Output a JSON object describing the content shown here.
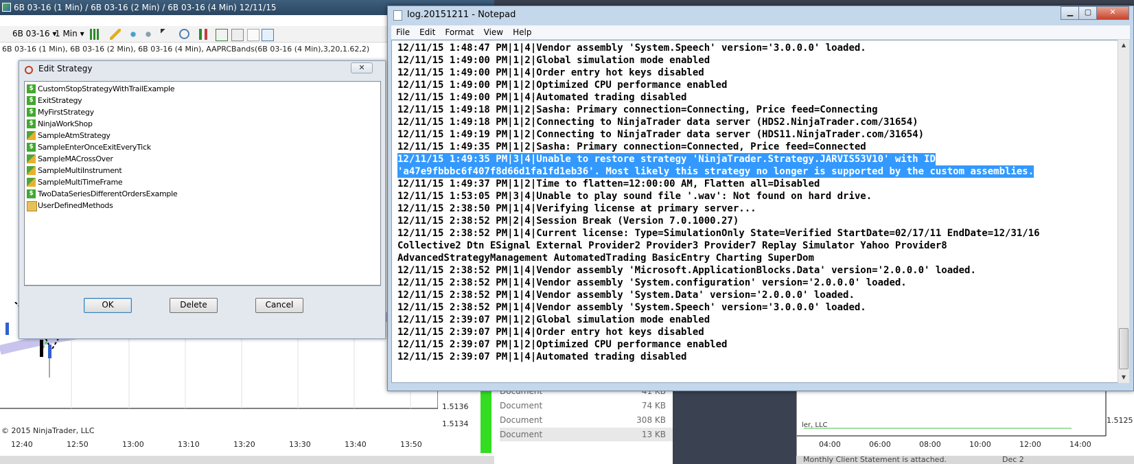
{
  "chart": {
    "title": "6B 03-16 (1 Min) / 6B 03-16 (2 Min) / 6B 03-16 (4 Min)  12/11/15",
    "instrument": "6B 03-16",
    "interval": "1 Min",
    "description": "6B 03-16 (1 Min), 6B 03-16 (2 Min), 6B 03-16 (4 Min), AAPRCBands(6B 03-16 (4 Min),3,20,1.62,2)",
    "copyright": "© 2015 NinjaTrader, LLC",
    "x_labels": [
      "12:40",
      "12:50",
      "13:00",
      "13:10",
      "13:20",
      "13:30",
      "13:40",
      "13:50"
    ],
    "price_labels": [
      "1.5136",
      "1.5134"
    ]
  },
  "explorer": {
    "rows": [
      {
        "type": "Document",
        "size": "41 KB"
      },
      {
        "type": "Document",
        "size": "74 KB"
      },
      {
        "type": "Document",
        "size": "308 KB"
      },
      {
        "type": "Document",
        "size": "13 KB"
      }
    ]
  },
  "right_chart": {
    "x_labels": [
      "04:00",
      "06:00",
      "08:00",
      "10:00",
      "12:00",
      "14:00"
    ],
    "price_label": "1.5125",
    "partial_text": "ler, LLC",
    "bottom_text": "Monthly Client Statement is attached.",
    "bottom_right": "Dec 2"
  },
  "notepad": {
    "title": "log.20151211 - Notepad",
    "menu": [
      "File",
      "Edit",
      "Format",
      "View",
      "Help"
    ],
    "lines": [
      "12/11/15 1:48:47 PM|1|4|Vendor assembly 'System.Speech' version='3.0.0.0' loaded.",
      "12/11/15 1:49:00 PM|1|2|Global simulation mode enabled",
      "12/11/15 1:49:00 PM|1|4|Order entry hot keys disabled",
      "12/11/15 1:49:00 PM|1|2|Optimized CPU performance enabled",
      "12/11/15 1:49:00 PM|1|4|Automated trading disabled",
      "12/11/15 1:49:18 PM|1|2|Sasha: Primary connection=Connecting, Price feed=Connecting",
      "12/11/15 1:49:18 PM|1|2|Connecting to NinjaTrader data server (HDS2.NinjaTrader.com/31654)",
      "12/11/15 1:49:19 PM|1|2|Connecting to NinjaTrader data server (HDS11.NinjaTrader.com/31654)",
      "12/11/15 1:49:35 PM|1|2|Sasha: Primary connection=Connected, Price feed=Connected",
      "12/11/15 1:49:35 PM|3|4|Unable to restore strategy 'NinjaTrader.Strategy.JARVIS53V10' with ID",
      "'a47e9fbbbc6f407f8d66d1fa1fd1eb36'. Most likely this strategy no longer is supported by the custom assemblies.",
      "12/11/15 1:49:37 PM|1|2|Time to flatten=12:00:00 AM, Flatten all=Disabled",
      "12/11/15 1:53:05 PM|3|4|Unable to play sound file '.wav': Not found on hard drive.",
      "12/11/15 2:38:50 PM|1|4|Verifying license at primary server...",
      "12/11/15 2:38:52 PM|2|4|Session Break (Version 7.0.1000.27)",
      "12/11/15 2:38:52 PM|1|4|Current license: Type=SimulationOnly State=Verified StartDate=02/17/11 EndDate=12/31/16",
      "Collective2 Dtn ESignal External Provider2 Provider3 Provider7 Replay Simulator Yahoo Provider8",
      "AdvancedStrategyManagement AutomatedTrading BasicEntry Charting SuperDom",
      "12/11/15 2:38:52 PM|1|4|Vendor assembly 'Microsoft.ApplicationBlocks.Data' version='2.0.0.0' loaded.",
      "12/11/15 2:38:52 PM|1|4|Vendor assembly 'System.configuration' version='2.0.0.0' loaded.",
      "12/11/15 2:38:52 PM|1|4|Vendor assembly 'System.Data' version='2.0.0.0' loaded.",
      "12/11/15 2:38:52 PM|1|4|Vendor assembly 'System.Speech' version='3.0.0.0' loaded.",
      "12/11/15 2:39:07 PM|1|2|Global simulation mode enabled",
      "12/11/15 2:39:07 PM|1|4|Order entry hot keys disabled",
      "12/11/15 2:39:07 PM|1|2|Optimized CPU performance enabled",
      "12/11/15 2:39:07 PM|1|4|Automated trading disabled"
    ],
    "selected_lines": [
      9,
      10
    ]
  },
  "dialog": {
    "title": "Edit Strategy",
    "items": [
      {
        "name": "CustomStopStrategyWithTrailExample",
        "icon": "strategy-icon"
      },
      {
        "name": "ExitStrategy",
        "icon": "strategy-icon"
      },
      {
        "name": "MyFirstStrategy",
        "icon": "strategy-icon"
      },
      {
        "name": "NinjaWorkShop",
        "icon": "strategy-icon"
      },
      {
        "name": "SampleAtmStrategy",
        "icon": "atm-strategy-icon"
      },
      {
        "name": "SampleEnterOnceExitEveryTick",
        "icon": "strategy-icon"
      },
      {
        "name": "SampleMACrossOver",
        "icon": "atm-strategy-icon"
      },
      {
        "name": "SampleMultiInstrument",
        "icon": "atm-strategy-icon"
      },
      {
        "name": "SampleMultiTimeFrame",
        "icon": "atm-strategy-icon"
      },
      {
        "name": "TwoDataSeriesDifferentOrdersExample",
        "icon": "strategy-icon"
      },
      {
        "name": "UserDefinedMethods",
        "icon": "folder-icon"
      }
    ],
    "ok_label": "OK",
    "delete_label": "Delete",
    "cancel_label": "Cancel"
  }
}
